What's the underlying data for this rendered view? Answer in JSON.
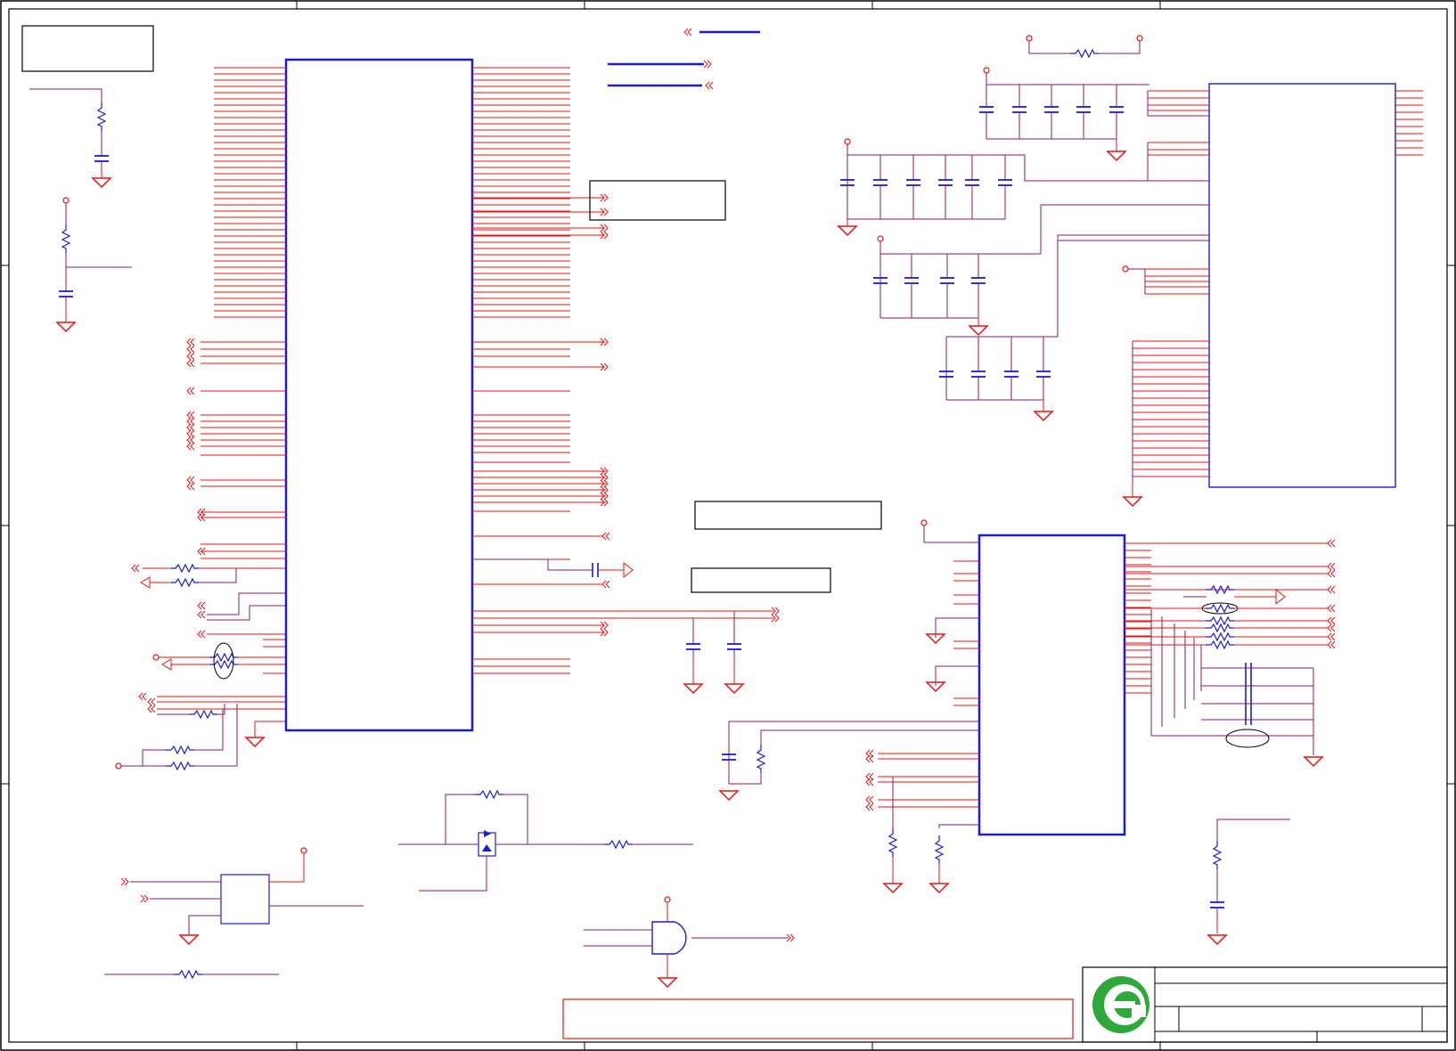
{
  "colors": {
    "background": "#ffffff",
    "frame": "#000000",
    "wire": "#ee1111",
    "net": "#8a1a6a",
    "component": "#1a1add",
    "power": "#ee1111",
    "logo": "#2fa83a"
  },
  "icons": {
    "title_block_logo": "green-e-logo-icon"
  },
  "text": {}
}
